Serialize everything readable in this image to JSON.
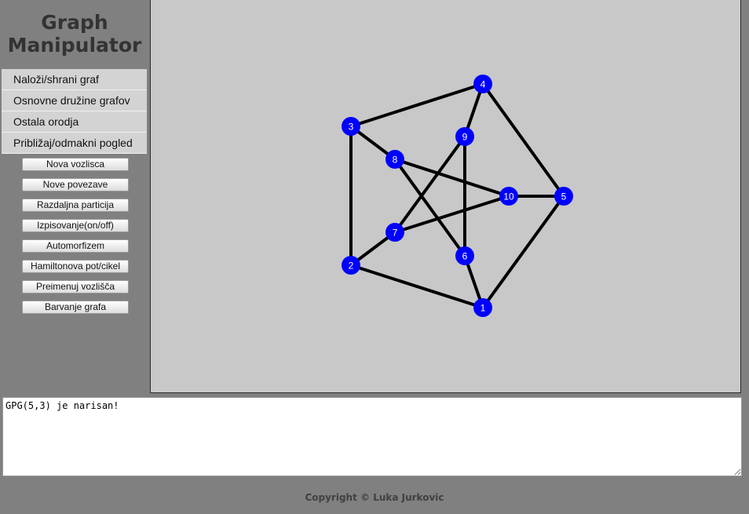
{
  "app": {
    "title_line1": "Graph",
    "title_line2": "Manipulator"
  },
  "menu": [
    {
      "label": "Naloži/shrani graf"
    },
    {
      "label": "Osnovne družine grafov"
    },
    {
      "label": "Ostala orodja"
    },
    {
      "label": "Približaj/odmakni pogled"
    }
  ],
  "actions": [
    {
      "label": "Nova vozlisca"
    },
    {
      "label": "Nove povezave"
    },
    {
      "label": "Razdaljna particija"
    },
    {
      "label": "Izpisovanje(on/off)"
    },
    {
      "label": "Automorfizem"
    },
    {
      "label": "Hamiltonova pot/cikel"
    },
    {
      "label": "Preimenuj vozlišča"
    },
    {
      "label": "Barvanje grafa"
    }
  ],
  "graph": {
    "node_color": "#0000ff",
    "edge_color": "#000000",
    "nodes": [
      "1",
      "2",
      "3",
      "4",
      "5",
      "6",
      "7",
      "8",
      "9",
      "10"
    ],
    "edges": [
      [
        "1",
        "2"
      ],
      [
        "2",
        "3"
      ],
      [
        "3",
        "4"
      ],
      [
        "4",
        "5"
      ],
      [
        "5",
        "1"
      ],
      [
        "1",
        "6"
      ],
      [
        "2",
        "7"
      ],
      [
        "3",
        "8"
      ],
      [
        "4",
        "9"
      ],
      [
        "5",
        "10"
      ],
      [
        "6",
        "8"
      ],
      [
        "8",
        "10"
      ],
      [
        "10",
        "7"
      ],
      [
        "7",
        "9"
      ],
      [
        "9",
        "6"
      ]
    ]
  },
  "console": {
    "text": "GPG(5,3) je narisan!"
  },
  "footer": {
    "copyright": "Copyright © Luka Jurkovic"
  }
}
